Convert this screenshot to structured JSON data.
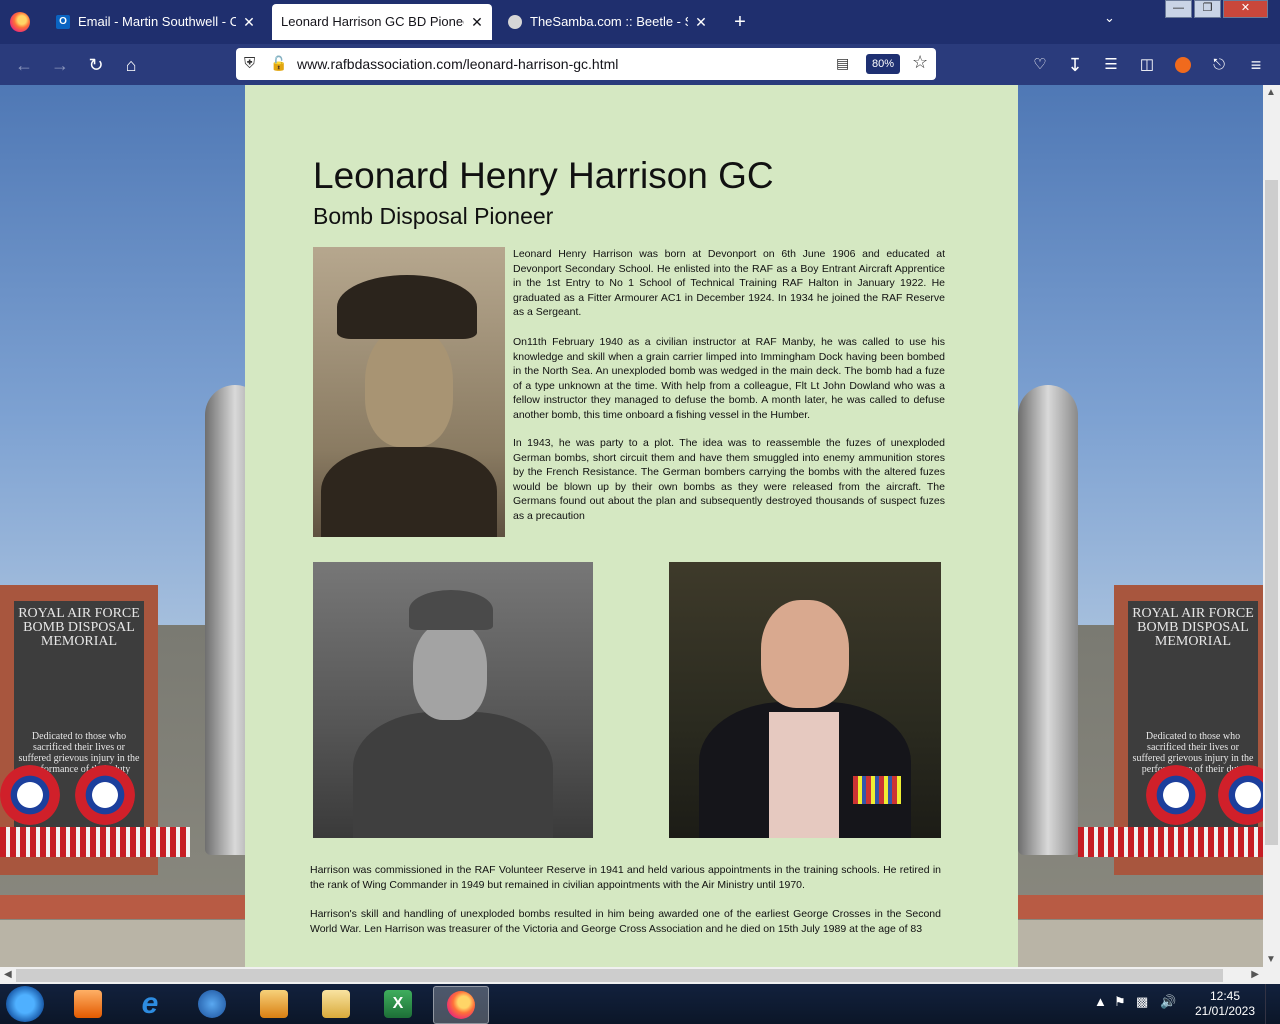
{
  "browser": {
    "tabs": [
      {
        "title": "Email - Martin Southwell - Outlook",
        "favicon": "outlook-icon",
        "active": false
      },
      {
        "title": "Leonard Harrison GC BD Pioneer",
        "favicon": "",
        "active": true
      },
      {
        "title": "TheSamba.com :: Beetle - Split-Window",
        "favicon": "samba-icon",
        "active": false
      }
    ],
    "new_tab_symbol": "+",
    "close_symbol": "✕",
    "url": "www.rafbdassociation.com/leonard-harrison-gc.html",
    "zoom": "80%"
  },
  "page": {
    "title": "Leonard Henry Harrison GC",
    "subtitle": "Bomb Disposal Pioneer",
    "paragraphs": [
      "Leonard Henry Harrison was born at Devonport on 6th June 1906 and educated at Devonport Secondary School.  He enlisted into the RAF as a Boy Entrant Aircraft Apprentice in the 1st Entry to No 1 School of Technical Training RAF Halton in January 1922.  He graduated as a Fitter Armourer AC1 in December 1924.  In 1934 he joined the RAF Reserve as a Sergeant.",
      "On11th February 1940 as a civilian instructor at RAF Manby, he was called to use his knowledge and skill when a grain carrier limped into Immingham Dock having been bombed in the North Sea.  An unexploded bomb was wedged in the main deck.  The bomb had a fuze of a type unknown at the time.  With help from a colleague, Flt Lt John Dowland who was a fellow instructor they managed to defuse the bomb.  A month later, he was called to defuse another bomb, this time onboard a fishing vessel in the Humber.",
      "In 1943, he was party to a plot.  The idea was to reassemble the fuzes of unexploded German bombs, short circuit them and have them smuggled into enemy ammunition stores by the French Resistance.  The German bombers carrying the bombs with the  altered fuzes would be blown up by their own bombs as they were released from the aircraft.  The Germans found out about the plan and subsequently destroyed  thousands of suspect fuzes as a precaution",
      "Harrison was commissioned in the RAF Volunteer Reserve in 1941 and held various appointments in the training schools.  He retired in the rank of Wing Commander in 1949 but remained in civilian appointments with the Air Ministry until 1970.",
      "Harrison's skill and handling of unexploded bombs resulted in him being awarded one of the earliest George Crosses in the Second World War.  Len Harrison was treasurer of the Victoria and George Cross Association and he died on 15th July 1989 at the age of 83"
    ]
  },
  "background": {
    "memorial_lines": [
      "ROYAL AIR FORCE",
      "BOMB DISPOSAL",
      "MEMORIAL"
    ],
    "dedication_lines": [
      "Dedicated to those who",
      "sacrificed their lives or",
      "suffered grievous injury in the",
      "performance of their duty"
    ]
  },
  "taskbar": {
    "apps": [
      "start-icon",
      "mail-icon",
      "internet-explorer-icon",
      "outlook-icon",
      "media-player-icon",
      "file-explorer-icon",
      "excel-icon",
      "firefox-icon"
    ],
    "time": "12:45",
    "date": "21/01/2023"
  },
  "colors": {
    "content_bg": "#d5e8c2",
    "tabbar_bg": "#1f2f6e",
    "navbar_bg": "#2a3b7c"
  }
}
